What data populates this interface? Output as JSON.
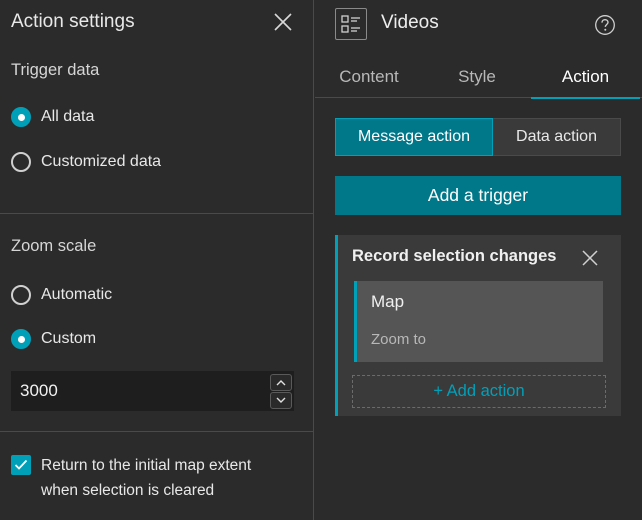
{
  "left_panel": {
    "title": "Action settings",
    "trigger_data": {
      "label": "Trigger data",
      "options": [
        {
          "label": "All data",
          "selected": true
        },
        {
          "label": "Customized data",
          "selected": false
        }
      ]
    },
    "zoom_scale": {
      "label": "Zoom scale",
      "options": [
        {
          "label": "Automatic",
          "selected": false
        },
        {
          "label": "Custom",
          "selected": true
        }
      ],
      "value": "3000"
    },
    "return_extent": {
      "checked": true,
      "line1": "Return to the initial map extent",
      "line2": "when selection is cleared"
    }
  },
  "right_panel": {
    "title": "Videos",
    "tabs": [
      {
        "label": "Content",
        "active": false
      },
      {
        "label": "Style",
        "active": false
      },
      {
        "label": "Action",
        "active": true
      }
    ],
    "segments": [
      {
        "label": "Message action",
        "active": true
      },
      {
        "label": "Data action",
        "active": false
      }
    ],
    "add_trigger_label": "Add a trigger",
    "trigger_card": {
      "title": "Record selection changes",
      "action": {
        "name": "Map",
        "type": "Zoom to"
      },
      "add_action_label": "+ Add action"
    }
  },
  "colors": {
    "accent": "#00a0b9",
    "accent_dark": "#00788a",
    "background": "#2b2b2b"
  }
}
